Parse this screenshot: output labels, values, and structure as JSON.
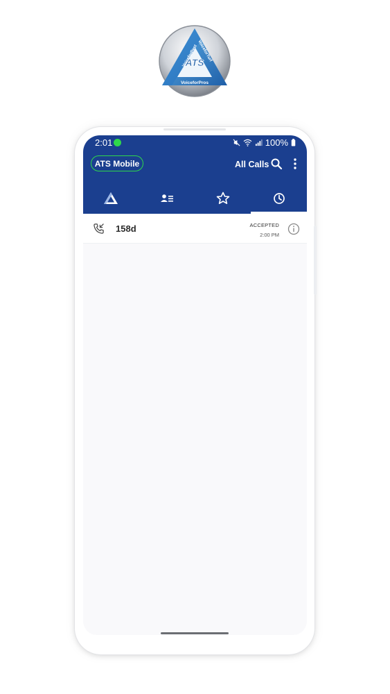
{
  "logo": {
    "lines": [
      "VoiceforPest",
      "VoiceforTurf",
      "VoiceforPros"
    ],
    "center_text": "ATS",
    "icon": "triangle-logo-icon"
  },
  "statusbar": {
    "time": "2:01",
    "battery": "100%",
    "icons": [
      "mute-icon",
      "wifi-icon",
      "signal-icon",
      "battery-icon"
    ]
  },
  "header": {
    "app_badge": "ATS Mobile",
    "filter_label": "All Calls",
    "search_icon": "search-icon",
    "menu_icon": "more-vert-icon"
  },
  "tabs": [
    {
      "name": "home",
      "icon": "triangle-icon",
      "active": false
    },
    {
      "name": "contacts",
      "icon": "contacts-icon",
      "active": false
    },
    {
      "name": "favorites",
      "icon": "star-icon",
      "active": false
    },
    {
      "name": "recents",
      "icon": "clock-icon",
      "active": true
    }
  ],
  "calls": [
    {
      "name": "158d",
      "status": "ACCEPTED",
      "time": "2:00 PM",
      "icon": "incoming-call-icon"
    }
  ],
  "colors": {
    "header_bg": "#1b3f8f",
    "accent_green": "#2fd84b",
    "list_bg": "#f9f9fb"
  }
}
